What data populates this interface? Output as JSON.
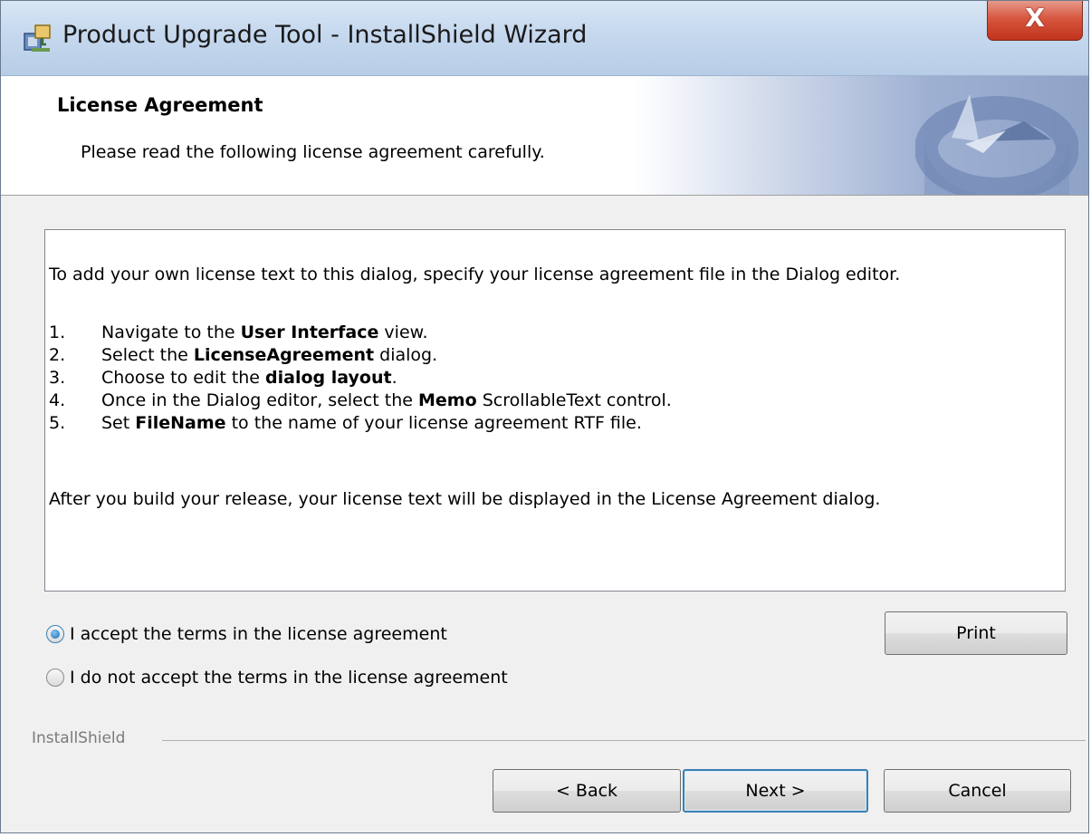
{
  "window": {
    "title": "Product Upgrade Tool - InstallShield Wizard",
    "close_label": "X"
  },
  "banner": {
    "title": "License Agreement",
    "subtitle": "Please read the following license agreement carefully."
  },
  "license": {
    "intro": "To add your own license text to this dialog, specify your license agreement file in the Dialog editor.",
    "steps": [
      {
        "num": "1.",
        "before": "Navigate to the ",
        "bold": "User Interface",
        "after": " view."
      },
      {
        "num": "2.",
        "before": "Select the ",
        "bold": "LicenseAgreement",
        "after": " dialog."
      },
      {
        "num": "3.",
        "before": "Choose to edit the ",
        "bold": "dialog layout",
        "after": "."
      },
      {
        "num": "4.",
        "before": "Once in the Dialog editor, select the ",
        "bold": "Memo",
        "after": " ScrollableText control."
      },
      {
        "num": "5.",
        "before": "Set ",
        "bold": "FileName",
        "after": " to the name of your license agreement RTF file."
      }
    ],
    "outro": "After you build your release, your license text will be displayed in the License Agreement dialog."
  },
  "options": {
    "accept_label": "I accept the terms in the license agreement",
    "decline_label": "I do not accept the terms in the license agreement",
    "selected": "accept"
  },
  "buttons": {
    "print": "Print",
    "back": "< Back",
    "next": "Next >",
    "cancel": "Cancel"
  },
  "footer": {
    "brand": "InstallShield"
  },
  "colors": {
    "close_button": "#c8391f",
    "title_bar": "#c5d8ee",
    "default_button_border": "#3c7fb1"
  }
}
